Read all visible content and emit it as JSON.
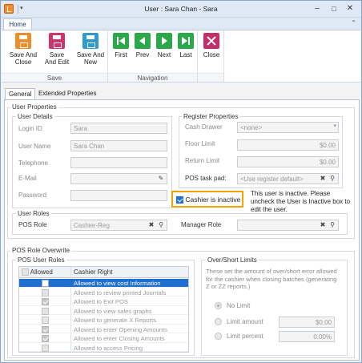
{
  "window": {
    "title": "User : Sara Chan - Sara",
    "minimize": "–",
    "maximize": "□",
    "close": "✕"
  },
  "ribbon": {
    "tab": "Home",
    "collapse": "⌃",
    "groups": {
      "save": {
        "label": "Save",
        "save_close_1": "Save And",
        "save_close_2": "Close",
        "save_edit_1": "Save",
        "save_edit_2": "And Edit",
        "save_new_1": "Save And",
        "save_new_2": "New"
      },
      "navigation": {
        "label": "Navigation",
        "first": "First",
        "prev": "Prev",
        "next": "Next",
        "last": "Last"
      },
      "close": {
        "label": "Close"
      }
    }
  },
  "tabs": {
    "general": "General",
    "extended": "Extended Properties"
  },
  "user_properties": {
    "title": "User Properties",
    "user_details": {
      "title": "User Details",
      "login_id_label": "Login ID",
      "login_id_value": "Sara",
      "user_name_label": "User Name",
      "user_name_value": "Sara Chan",
      "telephone_label": "Telephone",
      "telephone_value": "",
      "email_label": "E-Mail",
      "email_value": "",
      "password_label": "Password",
      "password_value": ""
    },
    "register_properties": {
      "title": "Register Properties",
      "cash_drawer_label": "Cash Drawer",
      "cash_drawer_value": "<none>",
      "floor_limit_label": "Floor Limit",
      "floor_limit_value": "$0.00",
      "return_limit_label": "Return Limit",
      "return_limit_value": "$0.00",
      "pos_task_pad_label": "POS task pad:",
      "pos_task_pad_value": "<Use register default>"
    },
    "inactive": {
      "label": "Cashier is inactive",
      "checked": true,
      "note": "This user is inactive.  Please uncheck the User is Inactive box to edit the user."
    },
    "user_roles": {
      "title": "User Roles",
      "pos_role_label": "POS Role",
      "pos_role_value": "Cashier-Reg",
      "manager_role_label": "Manager Role",
      "manager_role_value": ""
    }
  },
  "pos_role_overwrite": {
    "title": "POS Role Overwrite",
    "pos_user_roles": {
      "title": "POS User Roles",
      "col_allowed": "Allowed",
      "col_right": "Cashier Right",
      "rows": [
        {
          "allowed": false,
          "right": "Allowed to view cost Information",
          "selected": true
        },
        {
          "allowed": false,
          "right": "Allowed to review printed Journals",
          "selected": false
        },
        {
          "allowed": true,
          "right": "Allowed to Exit POS",
          "selected": false
        },
        {
          "allowed": false,
          "right": "Allowed to view sales graphs",
          "selected": false
        },
        {
          "allowed": false,
          "right": "Allowed to generate X Reports",
          "selected": false
        },
        {
          "allowed": true,
          "right": "Allowed to enter Opening Amounts",
          "selected": false
        },
        {
          "allowed": true,
          "right": "Allowed to enter Closing Amounts",
          "selected": false
        },
        {
          "allowed": false,
          "right": "Allowed to access Pricing",
          "selected": false
        }
      ]
    },
    "over_short": {
      "title": "Over/Short Limits",
      "description": "These set the amount of over/short error allowed for the cashier when closing batches (generating Z or ZZ reports.)",
      "no_limit": "No Limit",
      "limit_amount": "Limit amount",
      "limit_amount_value": "$0.00",
      "limit_percent": "Limit percent",
      "limit_percent_value": "0.00%",
      "selected": "No Limit"
    }
  },
  "colors": {
    "accent": "#1f6fd1",
    "highlight": "#f2a500"
  }
}
